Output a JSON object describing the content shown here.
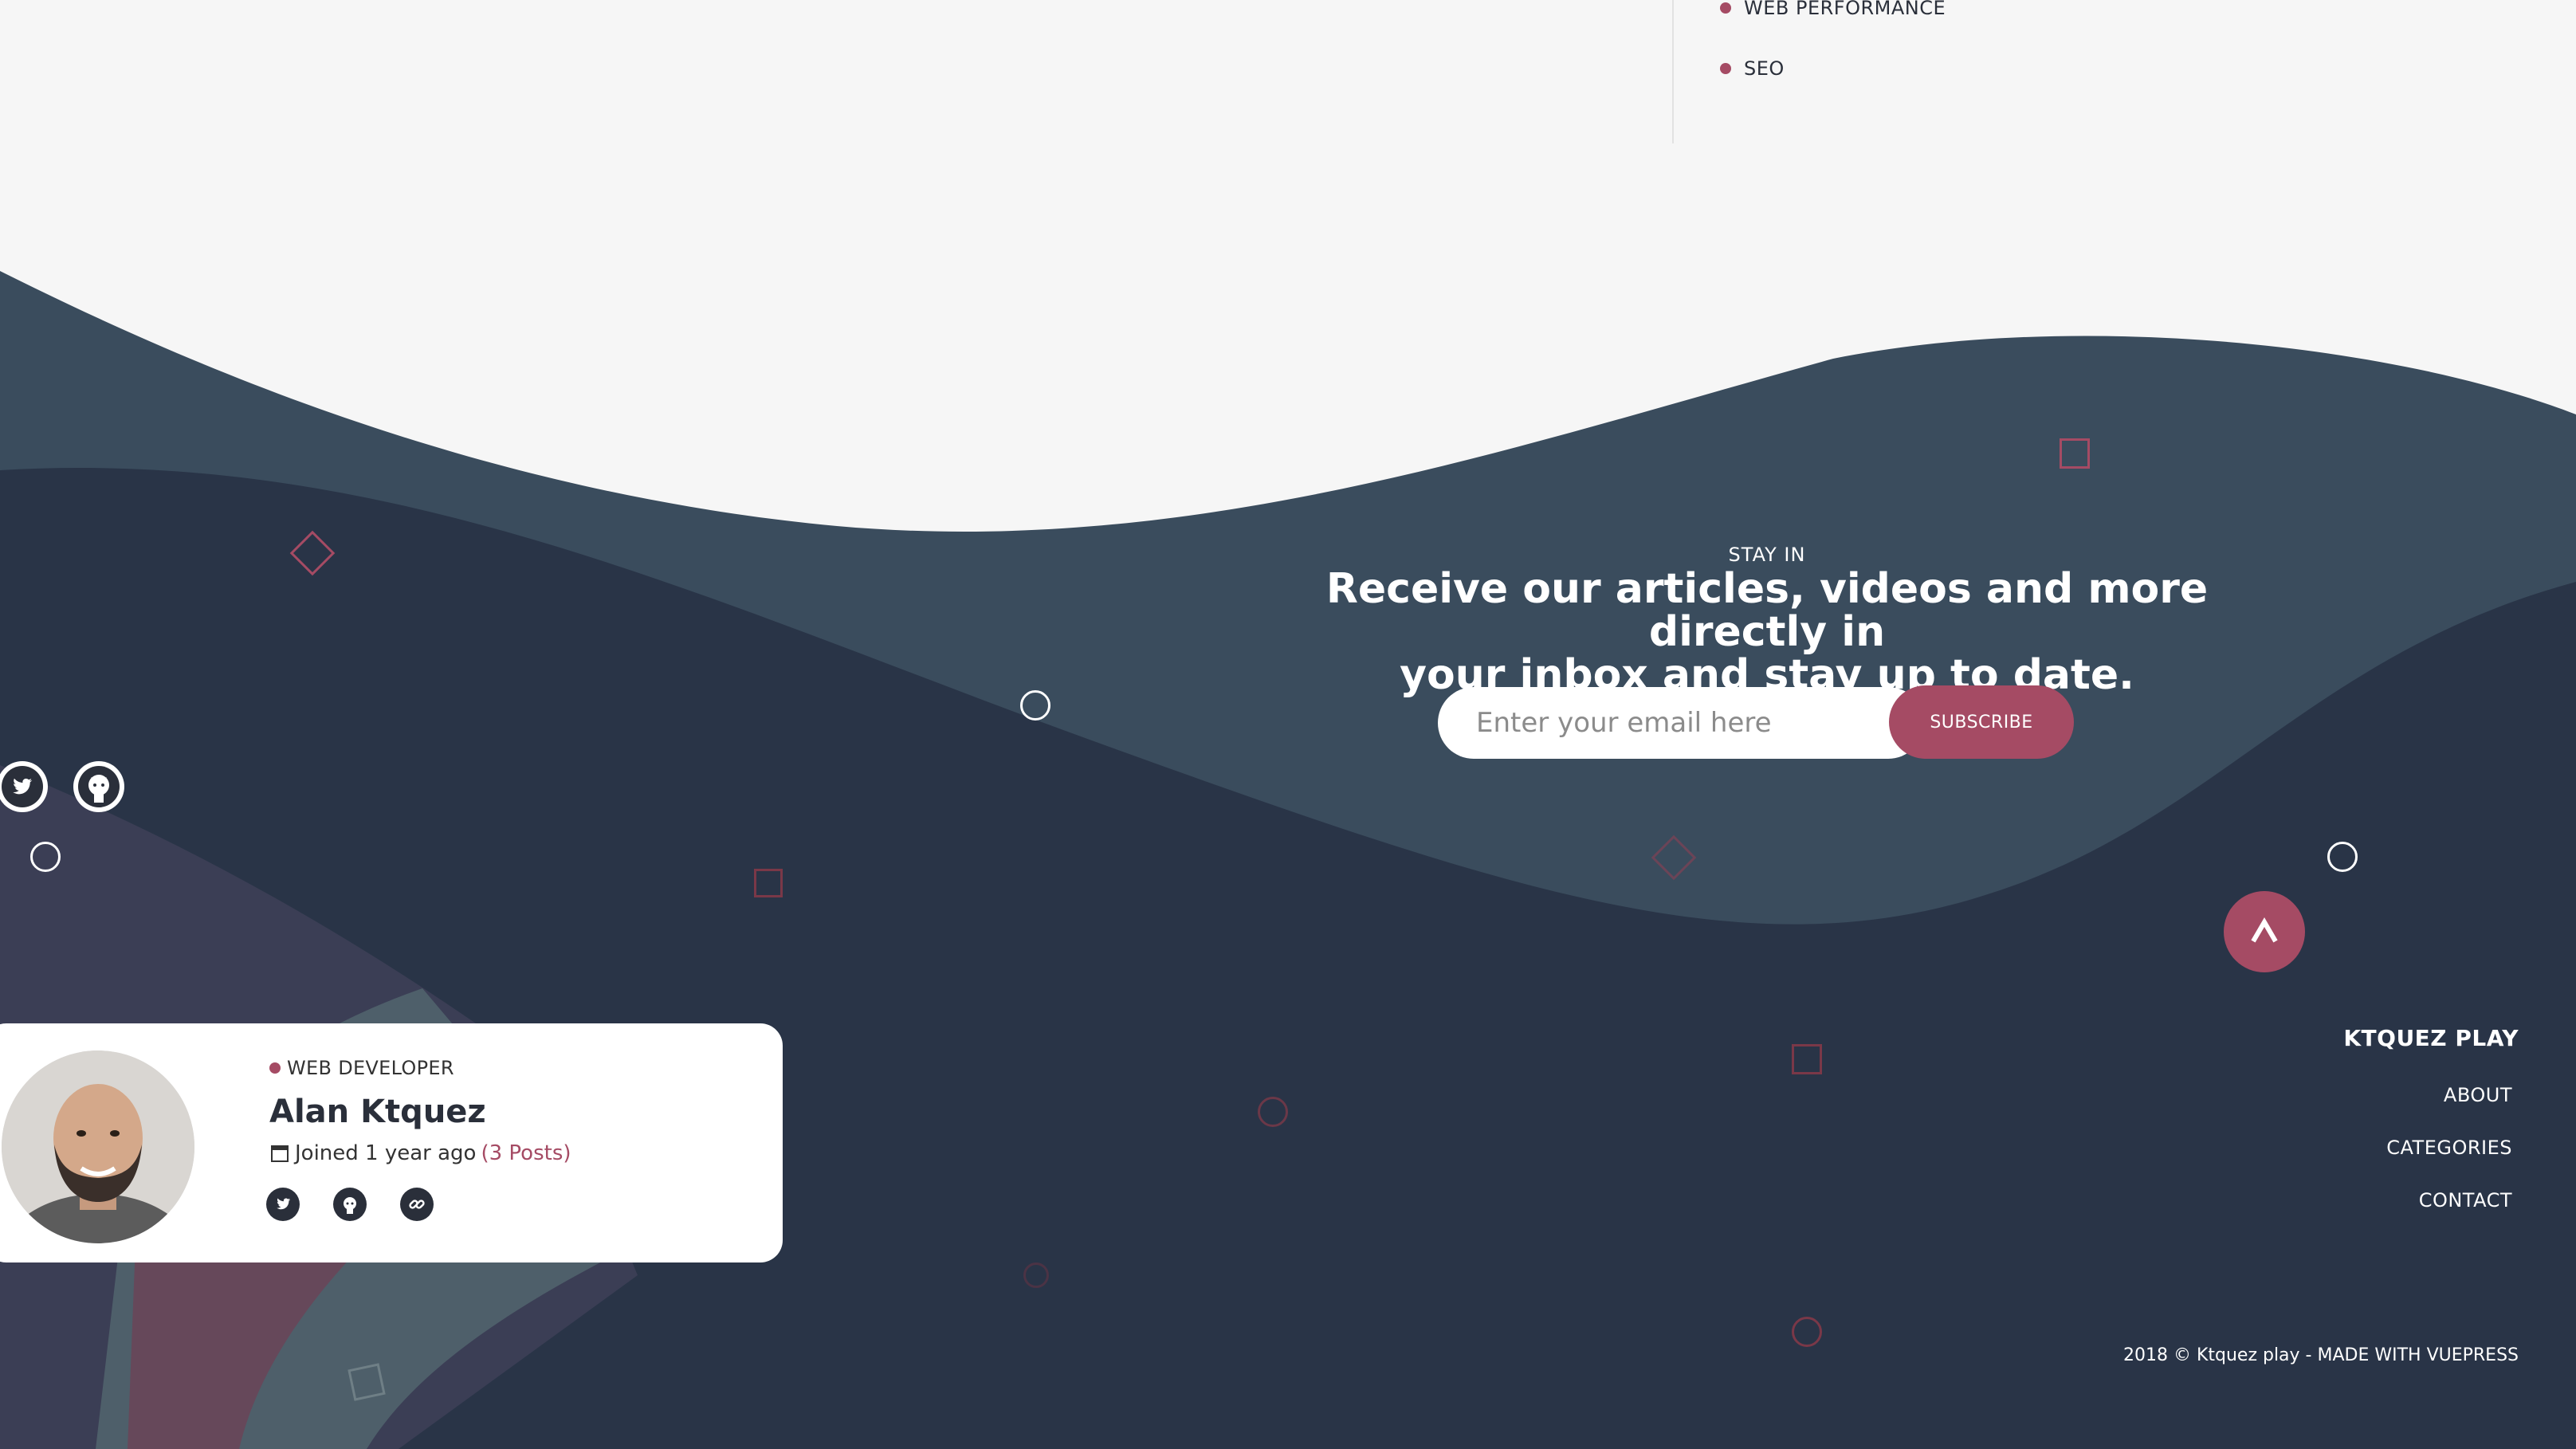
{
  "categories": {
    "items": [
      "WEB PERFORMANCE",
      "SEO"
    ]
  },
  "newsletter": {
    "label": "STAY IN",
    "title_line1": "Receive our articles, videos and more directly in",
    "title_line2": "your inbox and stay up to date.",
    "email_placeholder": "Enter your email here",
    "subscribe_label": "SUBSCRIBE"
  },
  "author": {
    "role": "WEB DEVELOPER",
    "name": "Alan Ktquez",
    "joined": "Joined 1 year ago",
    "posts": "(3 Posts)"
  },
  "footer": {
    "brand": "KTQUEZ PLAY",
    "links": [
      "ABOUT",
      "CATEGORIES",
      "CONTACT"
    ],
    "copyright": "2018 © Ktquez play - MADE WITH VUEPRESS"
  },
  "icons": {
    "float_social": [
      "twitter-icon",
      "github-icon"
    ],
    "author_social": [
      "twitter-icon",
      "github-icon",
      "link-icon"
    ],
    "back_to_top": "chevron-up-icon"
  },
  "colors": {
    "accent": "#a54b64",
    "wave_light": "#3a4c5d",
    "wave_dark": "#293447",
    "page_bg": "#f6f6f6"
  }
}
